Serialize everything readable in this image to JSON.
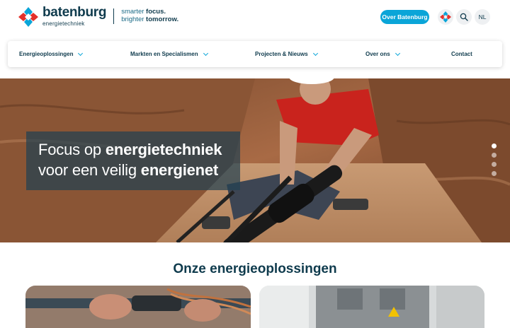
{
  "header": {
    "logo_name": "batenburg",
    "logo_sub": "energietechniek",
    "tagline_1a": "smarter ",
    "tagline_1b": "focus.",
    "tagline_2a": "brighter ",
    "tagline_2b": "tomorrow.",
    "over_button": "Over Batenburg",
    "lang": "NL"
  },
  "nav": {
    "items": [
      {
        "label": "Energieoplossingen"
      },
      {
        "label": "Markten en Specialismen"
      },
      {
        "label": "Projecten & Nieuws"
      },
      {
        "label": "Over ons"
      },
      {
        "label": "Contact"
      }
    ]
  },
  "hero": {
    "line1_a": "Focus op ",
    "line1_b": "energietechniek",
    "line2_a": "voor een veilig ",
    "line2_b": "energienet",
    "slides": 4,
    "active_slide": 1
  },
  "solutions": {
    "title": "Onze energieoplossingen"
  },
  "colors": {
    "brand_dark": "#0f3b4d",
    "brand_blue": "#0aa5d8",
    "brand_red": "#e4312b"
  },
  "icons": [
    "batenburg-logo-icon",
    "batenburg-mark-icon",
    "search-icon",
    "chevron-down-icon"
  ]
}
